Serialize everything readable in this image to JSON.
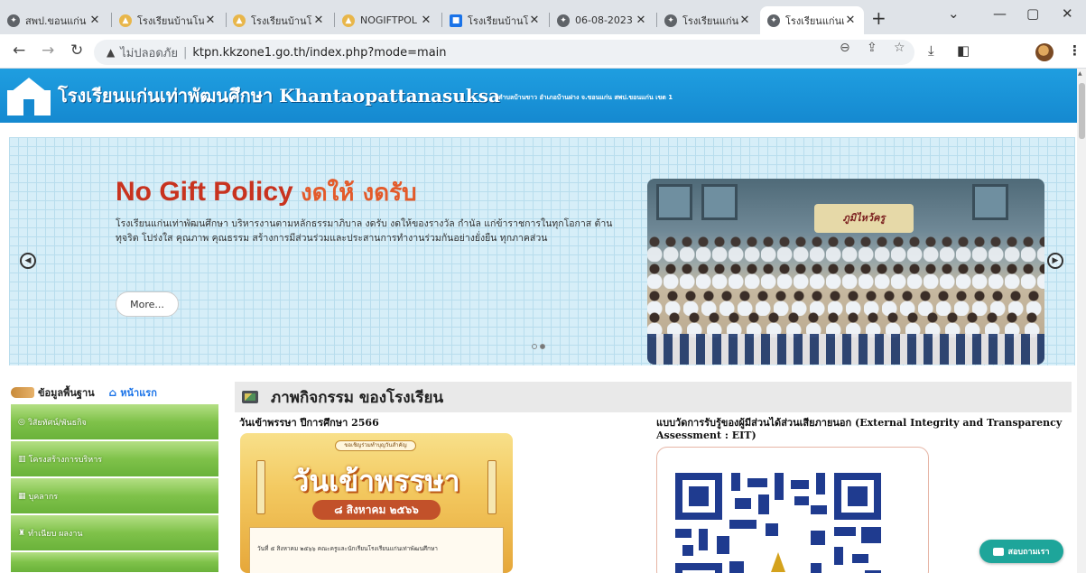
{
  "browser": {
    "tabs": [
      {
        "title": "สพป.ขอนแก่น",
        "icon_color": "#5f6368",
        "icon": "globe-icon"
      },
      {
        "title": "โรงเรียนบ้านโน",
        "icon_color": "#e8b64a",
        "icon": "school-icon"
      },
      {
        "title": "โรงเรียนบ้านโน",
        "icon_color": "#e8b64a",
        "icon": "school-icon"
      },
      {
        "title": "NOGIFTPOL",
        "icon_color": "#e8b64a",
        "icon": "school-icon"
      },
      {
        "title": "โรงเรียนบ้านโน",
        "icon_color": "#1a73e8",
        "icon": "site-icon"
      },
      {
        "title": "06-08-2023",
        "icon_color": "#5f6368",
        "icon": "globe-icon"
      },
      {
        "title": "โรงเรียนแก่นเท่า",
        "icon_color": "#5f6368",
        "icon": "globe-icon"
      },
      {
        "title": "โรงเรียนแก่นเท่า",
        "icon_color": "#5f6368",
        "icon": "globe-icon",
        "active": true
      }
    ],
    "security_label": "ไม่ปลอดภัย",
    "url": "ktpn.kkzone1.go.th/index.php?mode=main"
  },
  "header": {
    "title": "โรงเรียนแก่นเท่าพัฒนศึกษา Khantaopattanasuksa",
    "subtitle": "ตำบลบ้านขาว อำเภอบ้านฝาง จ.ขอนแก่น สพป.ขอนแก่น เขต 1"
  },
  "hero": {
    "title_en": "No Gift Policy",
    "title_th": "งดให้ งดรับ",
    "description": "โรงเรียนแก่นเท่าพัฒนศึกษา บริหารงานตามหลักธรรมาภิบาล งดรับ งดให้ของรางวัล กำนัล แก่ข้าราชการในทุกโอกาส ต้านทุจริต โปร่งใส คุณภาพ คุณธรรม สร้างการมีส่วนร่วมและประสานการทำงานร่วมกันอย่างยั่งยืน ทุกภาคส่วน",
    "more_label": "More...",
    "photo_banner": "ภูมิไหว้ครู",
    "slide_count": 2,
    "active_slide": 2
  },
  "sidebar": {
    "basic_info_label": "ข้อมูลพื้นฐาน",
    "home_label": "หน้าแรก",
    "items": [
      {
        "label": "วิสัยทัศน์/พันธกิจ",
        "icon": "target-icon"
      },
      {
        "label": "โครงสร้างการบริหาร",
        "icon": "chart-icon"
      },
      {
        "label": "บุคลากร",
        "icon": "people-icon"
      },
      {
        "label": "ทำเนียบ ผลงาน",
        "icon": "award-icon"
      }
    ]
  },
  "main": {
    "section_title": "ภาพกิจกรรม ของโรงเรียน",
    "cards": [
      {
        "title": "วันเข้าพรรษา ปีการศึกษา 2566"
      },
      {
        "title": "แบบวัดการรับรู้ของผู้มีส่วนได้ส่วนเสียภายนอก (External Integrity and Transparency Assessment : EIT)"
      }
    ],
    "poster": {
      "pill": "ขอเชิญร่วมทำบุญวันสำคัญ",
      "big_text": "วันเข้าพรรษา",
      "date": "๘ สิงหาคม ๒๕๖๖",
      "caption": "วันที่ ๕ สิงหาคม ๒๕๖๖ คณะครูและนักเรียนโรงเรียนแก่นเท่าพัฒนศึกษา"
    }
  },
  "chat": {
    "label": "สอบถามเรา",
    "color": "#1ea59a"
  },
  "colors": {
    "header_blue": "#1589d0",
    "hero_red": "#c8331f",
    "sidebar_green": "#7fc24a"
  }
}
